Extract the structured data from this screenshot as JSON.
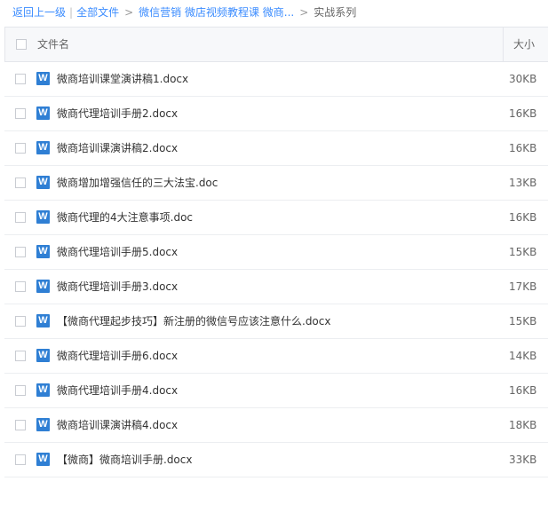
{
  "breadcrumb": {
    "back": "返回上一级",
    "root": "全部文件",
    "path1": "微信营销 微店视频教程课 微商...",
    "current": "实战系列"
  },
  "table": {
    "col_name": "文件名",
    "col_size": "大小"
  },
  "icons": {
    "file": "word-doc-icon",
    "glyph": "W",
    "color": "#2f7fd4"
  },
  "files": [
    {
      "name": "微商培训课堂演讲稿1.docx",
      "size": "30KB"
    },
    {
      "name": "微商代理培训手册2.docx",
      "size": "16KB"
    },
    {
      "name": "微商培训课演讲稿2.docx",
      "size": "16KB"
    },
    {
      "name": "微商增加增强信任的三大法宝.doc",
      "size": "13KB"
    },
    {
      "name": "微商代理的4大注意事项.doc",
      "size": "16KB"
    },
    {
      "name": "微商代理培训手册5.docx",
      "size": "15KB"
    },
    {
      "name": "微商代理培训手册3.docx",
      "size": "17KB"
    },
    {
      "name": "【微商代理起步技巧】新注册的微信号应该注意什么.docx",
      "size": "15KB"
    },
    {
      "name": "微商代理培训手册6.docx",
      "size": "14KB"
    },
    {
      "name": "微商代理培训手册4.docx",
      "size": "16KB"
    },
    {
      "name": "微商培训课演讲稿4.docx",
      "size": "18KB"
    },
    {
      "name": "【微商】微商培训手册.docx",
      "size": "33KB"
    }
  ]
}
